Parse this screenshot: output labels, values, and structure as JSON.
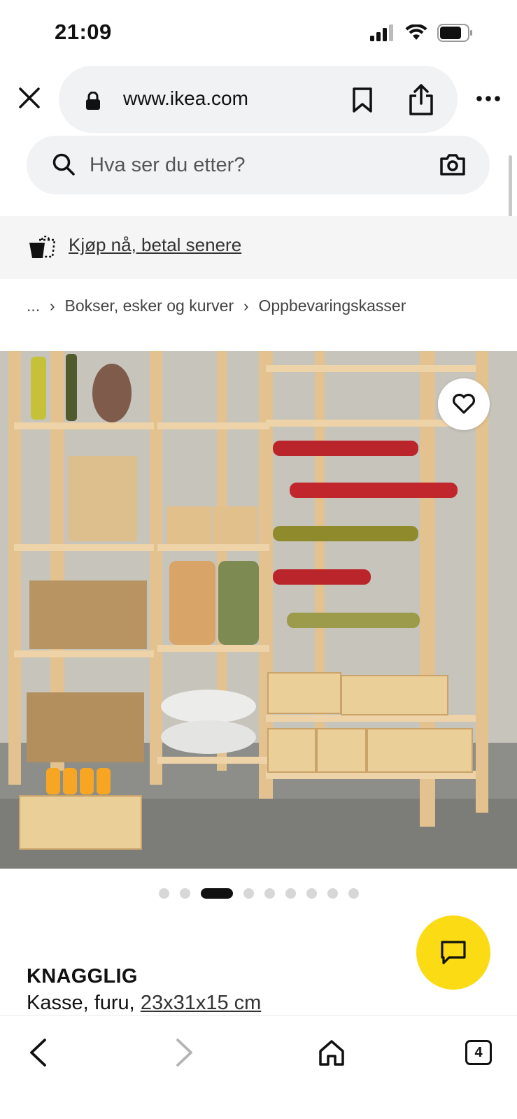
{
  "status_bar": {
    "time": "21:09"
  },
  "browser": {
    "url": "www.ikea.com",
    "icons": [
      "close-icon",
      "lock-icon",
      "bookmark-icon",
      "share-icon",
      "more-icon"
    ]
  },
  "search": {
    "placeholder": "Hva ser du etter?"
  },
  "promo": {
    "label": "Kjøp nå, betal senere"
  },
  "breadcrumb": {
    "root": "...",
    "items": [
      "Bokser, esker og kurver",
      "Oppbevaringskasser"
    ]
  },
  "gallery": {
    "total_images": 9,
    "active_index": 2
  },
  "product": {
    "name": "KNAGGLIG",
    "description_prefix": "Kasse, furu, ",
    "size": "23x31x15 cm"
  },
  "toolbar": {
    "tab_count": "4"
  },
  "colors": {
    "accent_yellow": "#fadb14",
    "pill_bg": "#f1f2f4",
    "promo_bg": "#f5f5f5",
    "text_dark": "#111111"
  }
}
